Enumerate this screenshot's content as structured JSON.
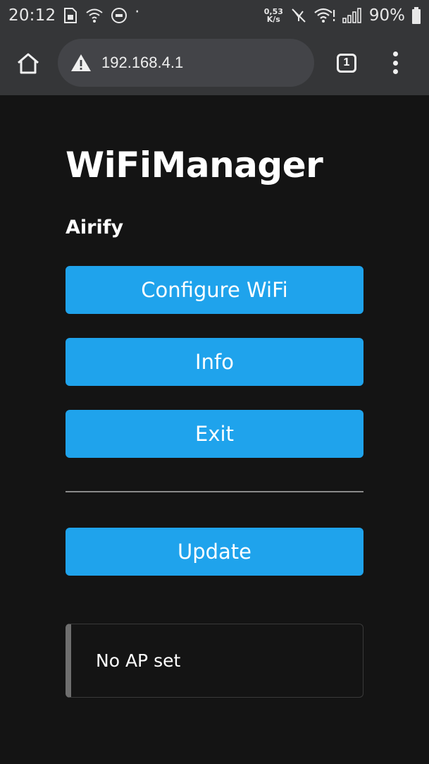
{
  "status_bar": {
    "time": "20:12",
    "speed_value": "0,53",
    "speed_unit": "K/s",
    "battery": "90%",
    "icons": [
      "sim-card-icon",
      "wifi-calling-icon",
      "message-icon",
      "dot-icon",
      "speed-icon",
      "mute-icon",
      "wifi-icon",
      "signal-icon",
      "battery-icon"
    ]
  },
  "browser": {
    "url": "192.168.4.1",
    "security_icon": "warning-icon",
    "tab_count": "1",
    "icons": [
      "home-icon",
      "tabs-icon",
      "more-menu-icon"
    ]
  },
  "page": {
    "title": "WiFiManager",
    "device_name": "Airify",
    "buttons": {
      "configure": "Configure WiFi",
      "info": "Info",
      "exit": "Exit",
      "update": "Update"
    },
    "message": "No AP set"
  },
  "colors": {
    "background": "#141414",
    "chrome": "#353638",
    "url_box": "#434448",
    "button": "#1fa3ec",
    "message_border": "#6f6f6f"
  }
}
